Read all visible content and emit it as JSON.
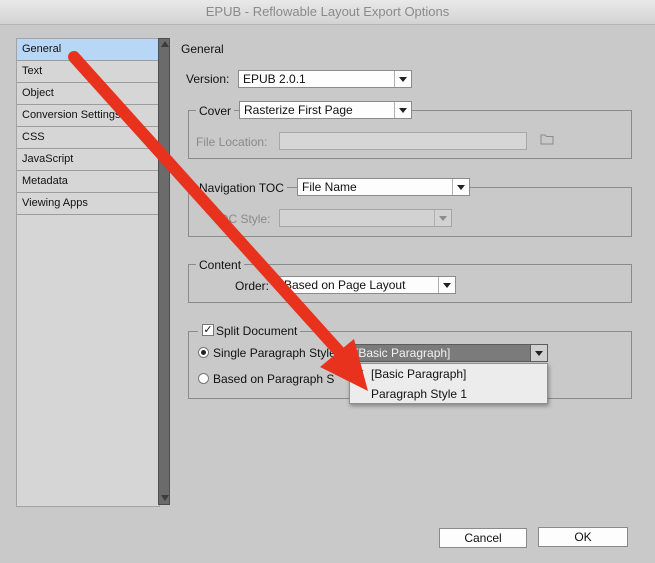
{
  "window": {
    "title": "EPUB - Reflowable Layout Export Options"
  },
  "sidebar": {
    "items": [
      {
        "label": "General",
        "selected": true
      },
      {
        "label": "Text"
      },
      {
        "label": "Object"
      },
      {
        "label": "Conversion Settings"
      },
      {
        "label": "CSS"
      },
      {
        "label": "JavaScript"
      },
      {
        "label": "Metadata"
      },
      {
        "label": "Viewing Apps"
      }
    ]
  },
  "main": {
    "section_title": "General",
    "version": {
      "label": "Version:",
      "value": "EPUB 2.0.1"
    },
    "cover": {
      "label": "Cover",
      "value": "Rasterize First Page",
      "file_location_label": "File Location:",
      "file_location_value": ""
    },
    "nav_toc": {
      "label": "Navigation TOC",
      "value": "File Name",
      "toc_style_label": "TOC Style:",
      "toc_style_value": ""
    },
    "content": {
      "label": "Content",
      "order_label": "Order:",
      "order_value": "Based on Page Layout"
    },
    "split": {
      "label": "Split Document",
      "checked": true,
      "single_label": "Single Paragraph Style",
      "single_value": "[Basic Paragraph]",
      "based_label": "Based on Paragraph S",
      "dropdown_options": [
        "[Basic Paragraph]",
        "Paragraph Style 1"
      ],
      "check_mark": "✓"
    }
  },
  "buttons": {
    "cancel": "Cancel",
    "ok": "OK"
  },
  "colors": {
    "annotation_arrow": "#e8321e",
    "selection": "#b8d6f5"
  }
}
